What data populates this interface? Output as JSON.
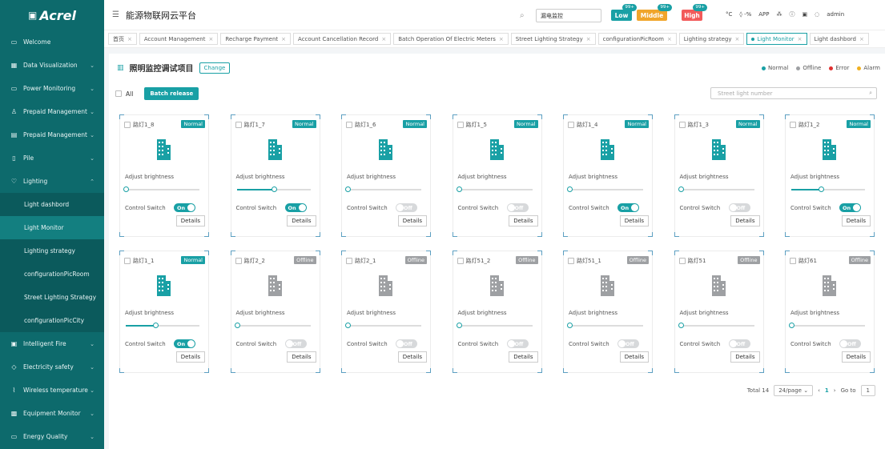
{
  "brand": {
    "logo": "Acrel"
  },
  "sidebar": {
    "items": [
      {
        "label": "Welcome",
        "icon": "monitor-icon",
        "chev": false
      },
      {
        "label": "Data Visualization",
        "icon": "chart-icon",
        "chev": true
      },
      {
        "label": "Power Monitoring",
        "icon": "monitor-icon",
        "chev": true
      },
      {
        "label": "Prepaid Management",
        "icon": "users-icon",
        "chev": true
      },
      {
        "label": "Prepaid Management",
        "icon": "card-icon",
        "chev": true
      },
      {
        "label": "Pile",
        "icon": "pile-icon",
        "chev": true
      },
      {
        "label": "Lighting",
        "icon": "bulb-icon",
        "chev": true
      }
    ],
    "sub_items": [
      {
        "label": "Light dashbord"
      },
      {
        "label": "Light Monitor"
      },
      {
        "label": "Lighting strategy"
      },
      {
        "label": "configurationPicRoom"
      },
      {
        "label": "Street Lighting Strategy"
      },
      {
        "label": "configurationPicCity"
      }
    ],
    "items2": [
      {
        "label": "Intelligent Fire",
        "icon": "fire-icon"
      },
      {
        "label": "Electricity safety",
        "icon": "shield-icon"
      },
      {
        "label": "Wireless temperature",
        "icon": "thermometer-icon"
      },
      {
        "label": "Equipment Monitor",
        "icon": "grid-icon"
      },
      {
        "label": "Energy Quality",
        "icon": "monitor-icon"
      }
    ]
  },
  "topbar": {
    "title": "能源物联网云平台",
    "search_value": "漏电监控",
    "levels": [
      {
        "label": "Low",
        "count": "99+",
        "color": "#19a0a5"
      },
      {
        "label": "Middle",
        "count": "99+",
        "color": "#f0a52b"
      },
      {
        "label": "High",
        "count": "99+",
        "color": "#f25a5a"
      }
    ],
    "tools": [
      "°C",
      "◊ -%",
      "APP",
      "admin"
    ]
  },
  "tabs": [
    {
      "label": "首页",
      "active": false
    },
    {
      "label": "Account Management",
      "active": false
    },
    {
      "label": "Recharge Payment",
      "active": false
    },
    {
      "label": "Account Cancellation Record",
      "active": false
    },
    {
      "label": "Batch Operation Of Electric Meters",
      "active": false
    },
    {
      "label": "Street Lighting Strategy",
      "active": false
    },
    {
      "label": "configurationPicRoom",
      "active": false
    },
    {
      "label": "Lighting strategy",
      "active": false
    },
    {
      "label": "Light Monitor",
      "active": true
    },
    {
      "label": "Light dashbord",
      "active": false
    }
  ],
  "page": {
    "title": "照明监控调试项目",
    "change_label": "Change",
    "all_label": "All",
    "batch_label": "Batch release",
    "search_placeholder": "Street light number"
  },
  "legend": [
    {
      "label": "Normal",
      "color": "#19a0a5"
    },
    {
      "label": "Offline",
      "color": "#9ea0a3"
    },
    {
      "label": "Error",
      "color": "#e03030"
    },
    {
      "label": "Alarm",
      "color": "#f0b020"
    }
  ],
  "card_labels": {
    "adjust": "Adjust brightness",
    "control": "Control Switch",
    "details": "Details",
    "on": "On",
    "off": "Off"
  },
  "lights": [
    {
      "name": "路灯1_8",
      "status": "Normal",
      "brightness": 0,
      "switch_on": true
    },
    {
      "name": "路灯1_7",
      "status": "Normal",
      "brightness": 0.5,
      "switch_on": true
    },
    {
      "name": "路灯1_6",
      "status": "Normal",
      "brightness": 0,
      "switch_on": false
    },
    {
      "name": "路灯1_5",
      "status": "Normal",
      "brightness": 0,
      "switch_on": false
    },
    {
      "name": "路灯1_4",
      "status": "Normal",
      "brightness": 0,
      "switch_on": true
    },
    {
      "name": "路灯1_3",
      "status": "Normal",
      "brightness": 0,
      "switch_on": false
    },
    {
      "name": "路灯1_2",
      "status": "Normal",
      "brightness": 0.4,
      "switch_on": true
    },
    {
      "name": "路灯1_1",
      "status": "Normal",
      "brightness": 0.4,
      "switch_on": true
    },
    {
      "name": "路灯2_2",
      "status": "Offline",
      "brightness": 0,
      "switch_on": false
    },
    {
      "name": "路灯2_1",
      "status": "Offline",
      "brightness": 0,
      "switch_on": false
    },
    {
      "name": "路灯51_2",
      "status": "Offline",
      "brightness": 0,
      "switch_on": false
    },
    {
      "name": "路灯51_1",
      "status": "Offline",
      "brightness": 0,
      "switch_on": false
    },
    {
      "name": "路灯51",
      "status": "Offline",
      "brightness": 0,
      "switch_on": false
    },
    {
      "name": "路灯61",
      "status": "Offline",
      "brightness": 0,
      "switch_on": false
    }
  ],
  "pagination": {
    "total": "Total 14",
    "page_size": "24/page",
    "current": "1",
    "goto_label": "Go to",
    "goto_value": "1"
  },
  "colors": {
    "accent": "#19a0a5",
    "sidebar": "#0d6a6c",
    "offline": "#9ea0a3"
  }
}
